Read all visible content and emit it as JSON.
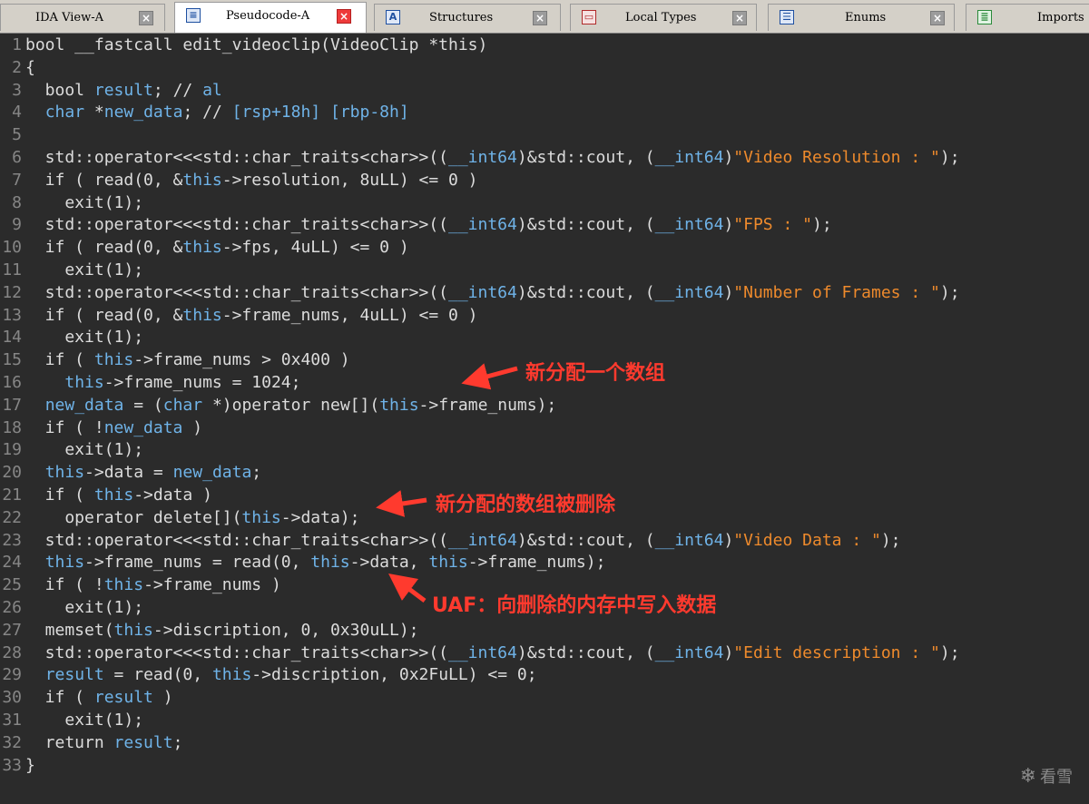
{
  "tabs": [
    {
      "label": "IDA View-A",
      "icon": "ida-view-icon",
      "active": false
    },
    {
      "label": "Pseudocode-A",
      "icon": "pseudocode-icon",
      "active": true
    },
    {
      "label": "Structures",
      "icon": "structures-icon",
      "active": false
    },
    {
      "label": "Local Types",
      "icon": "local-types-icon",
      "active": false
    },
    {
      "label": "Enums",
      "icon": "enums-icon",
      "active": false
    },
    {
      "label": "Imports",
      "icon": "imports-icon",
      "active": false
    }
  ],
  "code_lines": [
    {
      "n": "1",
      "tokens": [
        [
          "kw",
          "bool __fastcall edit_videoclip(VideoClip *this)"
        ]
      ]
    },
    {
      "n": "2",
      "tokens": [
        [
          "kw",
          "{"
        ]
      ]
    },
    {
      "n": "3",
      "tokens": [
        [
          "kw",
          "  bool "
        ],
        [
          "id",
          "result"
        ],
        [
          "kw",
          "; // "
        ],
        [
          "id",
          "al"
        ]
      ]
    },
    {
      "n": "4",
      "tokens": [
        [
          "kw",
          "  "
        ],
        [
          "id",
          "char"
        ],
        [
          "kw",
          " *"
        ],
        [
          "id",
          "new_data"
        ],
        [
          "kw",
          "; // "
        ],
        [
          "id",
          "[rsp+18h] [rbp-8h]"
        ]
      ]
    },
    {
      "n": "5",
      "tokens": []
    },
    {
      "n": "6",
      "tokens": [
        [
          "kw",
          "  std::operator<<<std::char_traits<char>>(("
        ],
        [
          "id",
          "__int64"
        ],
        [
          "kw",
          ")&std::cout, ("
        ],
        [
          "id",
          "__int64"
        ],
        [
          "kw",
          ")"
        ],
        [
          "str",
          "\"Video Resolution : \""
        ],
        [
          "kw",
          ");"
        ]
      ]
    },
    {
      "n": "7",
      "tokens": [
        [
          "kw",
          "  if ( read(0, &"
        ],
        [
          "id",
          "this"
        ],
        [
          "kw",
          "->resolution, 8uLL) <= 0 )"
        ]
      ]
    },
    {
      "n": "8",
      "tokens": [
        [
          "kw",
          "    exit(1);"
        ]
      ]
    },
    {
      "n": "9",
      "tokens": [
        [
          "kw",
          "  std::operator<<<std::char_traits<char>>(("
        ],
        [
          "id",
          "__int64"
        ],
        [
          "kw",
          ")&std::cout, ("
        ],
        [
          "id",
          "__int64"
        ],
        [
          "kw",
          ")"
        ],
        [
          "str",
          "\"FPS : \""
        ],
        [
          "kw",
          ");"
        ]
      ]
    },
    {
      "n": "10",
      "tokens": [
        [
          "kw",
          "  if ( read(0, &"
        ],
        [
          "id",
          "this"
        ],
        [
          "kw",
          "->fps, 4uLL) <= 0 )"
        ]
      ]
    },
    {
      "n": "11",
      "tokens": [
        [
          "kw",
          "    exit(1);"
        ]
      ]
    },
    {
      "n": "12",
      "tokens": [
        [
          "kw",
          "  std::operator<<<std::char_traits<char>>(("
        ],
        [
          "id",
          "__int64"
        ],
        [
          "kw",
          ")&std::cout, ("
        ],
        [
          "id",
          "__int64"
        ],
        [
          "kw",
          ")"
        ],
        [
          "str",
          "\"Number of Frames : \""
        ],
        [
          "kw",
          ");"
        ]
      ]
    },
    {
      "n": "13",
      "tokens": [
        [
          "kw",
          "  if ( read(0, &"
        ],
        [
          "id",
          "this"
        ],
        [
          "kw",
          "->frame_nums, 4uLL) <= 0 )"
        ]
      ]
    },
    {
      "n": "14",
      "tokens": [
        [
          "kw",
          "    exit(1);"
        ]
      ]
    },
    {
      "n": "15",
      "tokens": [
        [
          "kw",
          "  if ( "
        ],
        [
          "id",
          "this"
        ],
        [
          "kw",
          "->frame_nums > 0x400 )"
        ]
      ]
    },
    {
      "n": "16",
      "tokens": [
        [
          "kw",
          "    "
        ],
        [
          "id",
          "this"
        ],
        [
          "kw",
          "->frame_nums = 1024;"
        ]
      ]
    },
    {
      "n": "17",
      "tokens": [
        [
          "kw",
          "  "
        ],
        [
          "id",
          "new_data"
        ],
        [
          "kw",
          " = ("
        ],
        [
          "id",
          "char"
        ],
        [
          "kw",
          " *)operator new[]("
        ],
        [
          "id",
          "this"
        ],
        [
          "kw",
          "->frame_nums);"
        ]
      ]
    },
    {
      "n": "18",
      "tokens": [
        [
          "kw",
          "  if ( !"
        ],
        [
          "id",
          "new_data"
        ],
        [
          "kw",
          " )"
        ]
      ]
    },
    {
      "n": "19",
      "tokens": [
        [
          "kw",
          "    exit(1);"
        ]
      ]
    },
    {
      "n": "20",
      "tokens": [
        [
          "kw",
          "  "
        ],
        [
          "id",
          "this"
        ],
        [
          "kw",
          "->data = "
        ],
        [
          "id",
          "new_data"
        ],
        [
          "kw",
          ";"
        ]
      ]
    },
    {
      "n": "21",
      "tokens": [
        [
          "kw",
          "  if ( "
        ],
        [
          "id",
          "this"
        ],
        [
          "kw",
          "->data )"
        ]
      ]
    },
    {
      "n": "22",
      "tokens": [
        [
          "kw",
          "    operator delete[]("
        ],
        [
          "id",
          "this"
        ],
        [
          "kw",
          "->data);"
        ]
      ]
    },
    {
      "n": "23",
      "tokens": [
        [
          "kw",
          "  std::operator<<<std::char_traits<char>>(("
        ],
        [
          "id",
          "__int64"
        ],
        [
          "kw",
          ")&std::cout, ("
        ],
        [
          "id",
          "__int64"
        ],
        [
          "kw",
          ")"
        ],
        [
          "str",
          "\"Video Data : \""
        ],
        [
          "kw",
          ");"
        ]
      ]
    },
    {
      "n": "24",
      "tokens": [
        [
          "kw",
          "  "
        ],
        [
          "id",
          "this"
        ],
        [
          "kw",
          "->frame_nums = read(0, "
        ],
        [
          "id",
          "this"
        ],
        [
          "kw",
          "->data, "
        ],
        [
          "id",
          "this"
        ],
        [
          "kw",
          "->frame_nums);"
        ]
      ]
    },
    {
      "n": "25",
      "tokens": [
        [
          "kw",
          "  if ( !"
        ],
        [
          "id",
          "this"
        ],
        [
          "kw",
          "->frame_nums )"
        ]
      ]
    },
    {
      "n": "26",
      "tokens": [
        [
          "kw",
          "    exit(1);"
        ]
      ]
    },
    {
      "n": "27",
      "tokens": [
        [
          "kw",
          "  memset("
        ],
        [
          "id",
          "this"
        ],
        [
          "kw",
          "->discription, 0, 0x30uLL);"
        ]
      ]
    },
    {
      "n": "28",
      "tokens": [
        [
          "kw",
          "  std::operator<<<std::char_traits<char>>(("
        ],
        [
          "id",
          "__int64"
        ],
        [
          "kw",
          ")&std::cout, ("
        ],
        [
          "id",
          "__int64"
        ],
        [
          "kw",
          ")"
        ],
        [
          "str",
          "\"Edit description : \""
        ],
        [
          "kw",
          ");"
        ]
      ]
    },
    {
      "n": "29",
      "tokens": [
        [
          "kw",
          "  "
        ],
        [
          "id",
          "result"
        ],
        [
          "kw",
          " = read(0, "
        ],
        [
          "id",
          "this"
        ],
        [
          "kw",
          "->discription, 0x2FuLL) <= 0;"
        ]
      ]
    },
    {
      "n": "30",
      "tokens": [
        [
          "kw",
          "  if ( "
        ],
        [
          "id",
          "result"
        ],
        [
          "kw",
          " )"
        ]
      ]
    },
    {
      "n": "31",
      "tokens": [
        [
          "kw",
          "    exit(1);"
        ]
      ]
    },
    {
      "n": "32",
      "tokens": [
        [
          "kw",
          "  return "
        ],
        [
          "id",
          "result"
        ],
        [
          "kw",
          ";"
        ]
      ]
    },
    {
      "n": "33",
      "tokens": [
        [
          "kw",
          "}"
        ]
      ]
    }
  ],
  "annotations": {
    "alloc": "新分配一个数组",
    "deleted": "新分配的数组被删除",
    "uaf": "UAF：向删除的内存中写入数据"
  },
  "watermark": {
    "text": "看雪",
    "icon": "snowflake-icon"
  },
  "colors": {
    "background": "#2b2b2b",
    "text": "#dcdcdc",
    "identifier": "#6fb3e8",
    "string": "#ee8a2c",
    "annotation": "#ff3a2e",
    "line_number": "#868686"
  }
}
